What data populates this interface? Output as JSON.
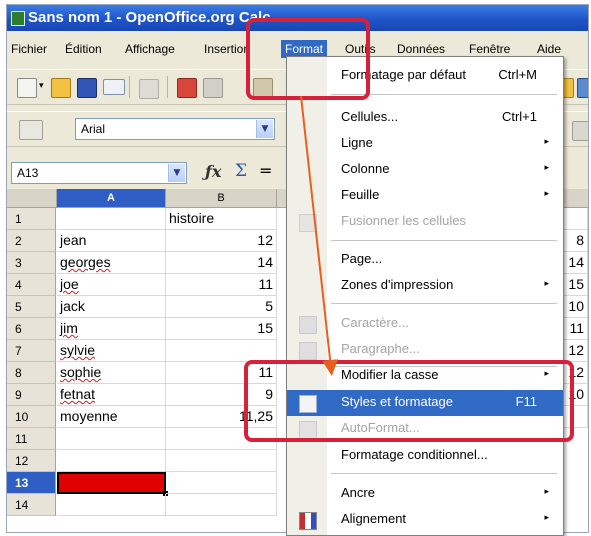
{
  "window": {
    "title": "Sans nom 1 - OpenOffice.org Calc"
  },
  "menubar": [
    "Fichier",
    "Édition",
    "Affichage",
    "Insertion",
    "Format",
    "Outils",
    "Données",
    "Fenêtre",
    "Aide"
  ],
  "font_box": {
    "value": "Arial"
  },
  "name_box": {
    "value": "A13"
  },
  "columns": [
    "A",
    "B"
  ],
  "rows": [
    {
      "n": "1",
      "a": "",
      "b": "histoire",
      "c": ""
    },
    {
      "n": "2",
      "a": "jean",
      "b": "12",
      "c": "8"
    },
    {
      "n": "3",
      "a": "georges",
      "b": "14",
      "c": "14"
    },
    {
      "n": "4",
      "a": "joe",
      "b": "11",
      "c": "15"
    },
    {
      "n": "5",
      "a": "jack",
      "b": "5",
      "c": "10"
    },
    {
      "n": "6",
      "a": "jim",
      "b": "15",
      "c": "11"
    },
    {
      "n": "7",
      "a": "sylvie",
      "b": "",
      "c": "12"
    },
    {
      "n": "8",
      "a": "sophie",
      "b": "11",
      "c": "12"
    },
    {
      "n": "9",
      "a": "fetnat",
      "b": "9",
      "c": "10"
    },
    {
      "n": "10",
      "a": "moyenne",
      "b": "11,25",
      "c": ""
    },
    {
      "n": "11",
      "a": "",
      "b": "",
      "c": ""
    },
    {
      "n": "12",
      "a": "",
      "b": "",
      "c": ""
    },
    {
      "n": "13",
      "a": "",
      "b": "",
      "c": ""
    },
    {
      "n": "14",
      "a": "",
      "b": "",
      "c": ""
    }
  ],
  "format_menu": {
    "items": [
      {
        "label": "Formatage par défaut",
        "shortcut": "Ctrl+M",
        "arrow": "",
        "disabled": false
      },
      {
        "label": "Cellules...",
        "shortcut": "Ctrl+1",
        "arrow": "",
        "disabled": false
      },
      {
        "label": "Ligne",
        "shortcut": "",
        "arrow": "▸",
        "disabled": false
      },
      {
        "label": "Colonne",
        "shortcut": "",
        "arrow": "▸",
        "disabled": false
      },
      {
        "label": "Feuille",
        "shortcut": "",
        "arrow": "▸",
        "disabled": false
      },
      {
        "label": "Fusionner les cellules",
        "shortcut": "",
        "arrow": "",
        "disabled": true
      },
      {
        "label": "Page...",
        "shortcut": "",
        "arrow": "",
        "disabled": false
      },
      {
        "label": "Zones d'impression",
        "shortcut": "",
        "arrow": "▸",
        "disabled": false
      },
      {
        "label": "Caractère...",
        "shortcut": "",
        "arrow": "",
        "disabled": true
      },
      {
        "label": "Paragraphe...",
        "shortcut": "",
        "arrow": "",
        "disabled": true
      },
      {
        "label": "Modifier la casse",
        "shortcut": "",
        "arrow": "▸",
        "disabled": false
      },
      {
        "label": "Styles et formatage",
        "shortcut": "F11",
        "arrow": "",
        "disabled": false,
        "highlighted": true
      },
      {
        "label": "AutoFormat...",
        "shortcut": "",
        "arrow": "",
        "disabled": true
      },
      {
        "label": "Formatage conditionnel...",
        "shortcut": "",
        "arrow": "",
        "disabled": false
      },
      {
        "label": "Ancre",
        "shortcut": "",
        "arrow": "▸",
        "disabled": false
      },
      {
        "label": "Alignement",
        "shortcut": "",
        "arrow": "▸",
        "disabled": false
      }
    ]
  },
  "colors": {
    "annotation_red": "#d7203a",
    "selection_blue": "#316ac5",
    "fill_red": "#e00000"
  }
}
